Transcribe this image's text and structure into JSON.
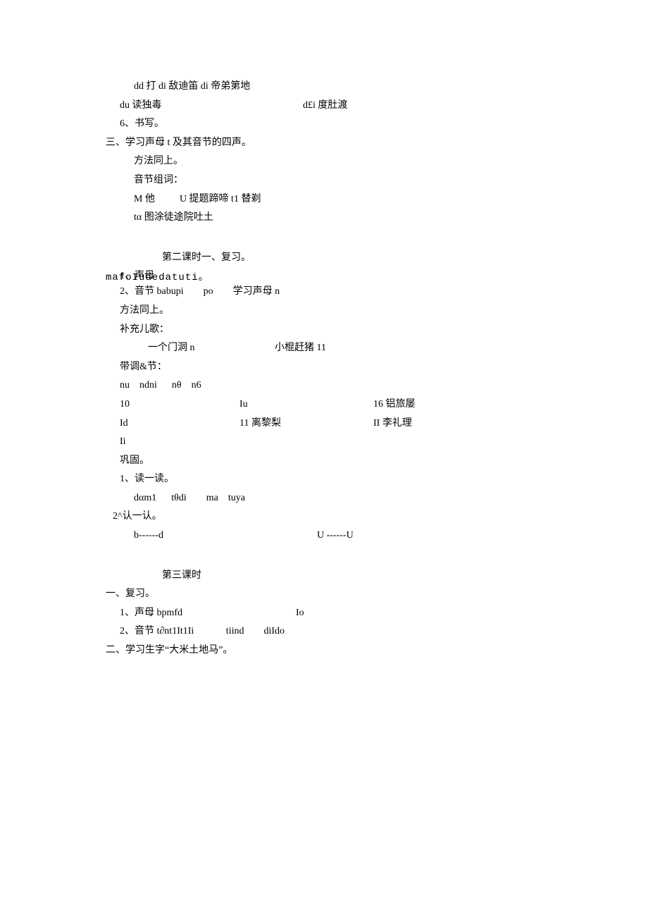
{
  "l1": "dd 打 di 敌迪笛 di 帝弟第地",
  "l2a": "du 读独毒",
  "l2b": "d£i 度肚渡",
  "l3": "6、书写。",
  "l4": "三、学习声母 t 及其音节的四声。",
  "l5": "方法同上。",
  "l6": "音节组词：",
  "l7": "M 他          U 提题蹄啼 t1 替剃",
  "l8": "tα 图涂徒途院吐土",
  "l9": "第二课时一、复习。",
  "l10a": "1、声母",
  "l10b": "mafoIudedatuti。",
  "l11": "2、音节 babupi        po        学习声母 n",
  "l12": "方法同上。",
  "l13": "补充儿歌：",
  "l14a": "一个门洞 n",
  "l14b": "小棍赶猪 11",
  "l15": "带调&节：",
  "l16": "nu    ndni      nθ    n6",
  "l17a": "10",
  "l17b": "Iu",
  "l17c": "16 铝旅屡",
  "l18a": "Id",
  "l18b": "11 离黎梨",
  "l18c": "II 李礼理",
  "l19": "Ii",
  "l20": "巩固。",
  "l21": "1、读一读。",
  "l22": "dαm1      tθdi        ma    tuya",
  "l23": "2^认一认。",
  "l24a": "b------d",
  "l24b": "U ------U",
  "l25": "第三课时",
  "l26": "一、复习。",
  "l27a": "1、声母 bpmfd",
  "l27b": "Io",
  "l28": "2、音节 t∂nt1It1Ii             tiind        diIdo",
  "l29": "二、学习生字“大米土地马”。"
}
